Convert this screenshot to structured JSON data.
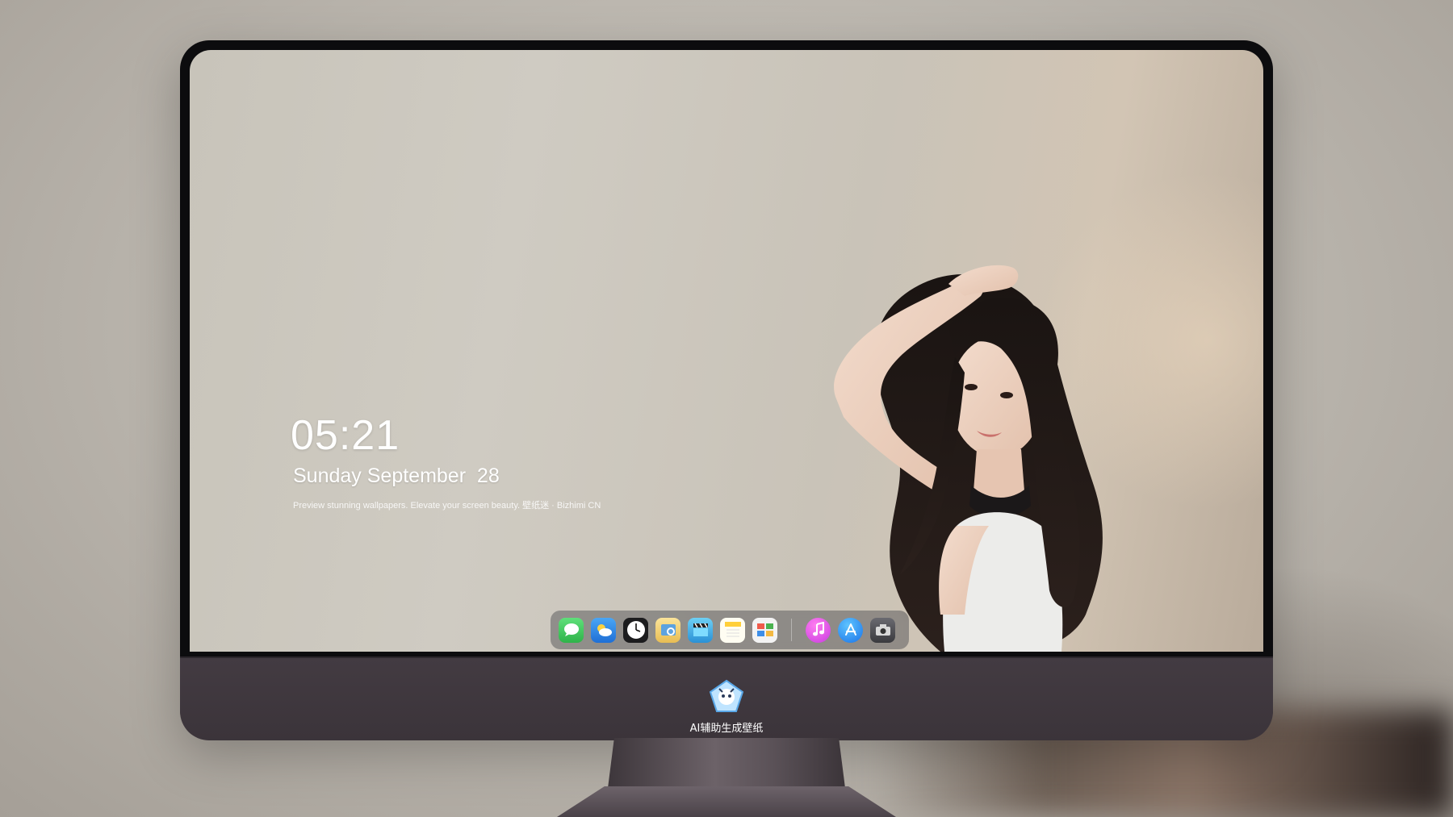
{
  "lock_screen": {
    "time": "05:21",
    "date": "Sunday September  28",
    "tagline": "Preview stunning wallpapers. Elevate your screen beauty. 壁纸迷 · Bizhimi CN"
  },
  "dock": {
    "apps": [
      {
        "name": "messages-icon",
        "color": "#35c759"
      },
      {
        "name": "weather-icon",
        "color": "#2f8df0"
      },
      {
        "name": "clock-icon",
        "color": "#1c1c1e"
      },
      {
        "name": "preview-icon",
        "color": "#f4d47a"
      },
      {
        "name": "clips-icon",
        "color": "#3aa7e8"
      },
      {
        "name": "notes-icon",
        "color": "#ffd54a"
      },
      {
        "name": "photo-booth-icon",
        "color": "#e85b4a"
      },
      {
        "name": "music-icon",
        "color": "#e64fe1"
      },
      {
        "name": "app-store-icon",
        "color": "#1f8ef1"
      },
      {
        "name": "camera-icon",
        "color": "#4a4a4e"
      }
    ]
  },
  "monitor": {
    "chin_label": "AI辅助生成壁纸"
  }
}
